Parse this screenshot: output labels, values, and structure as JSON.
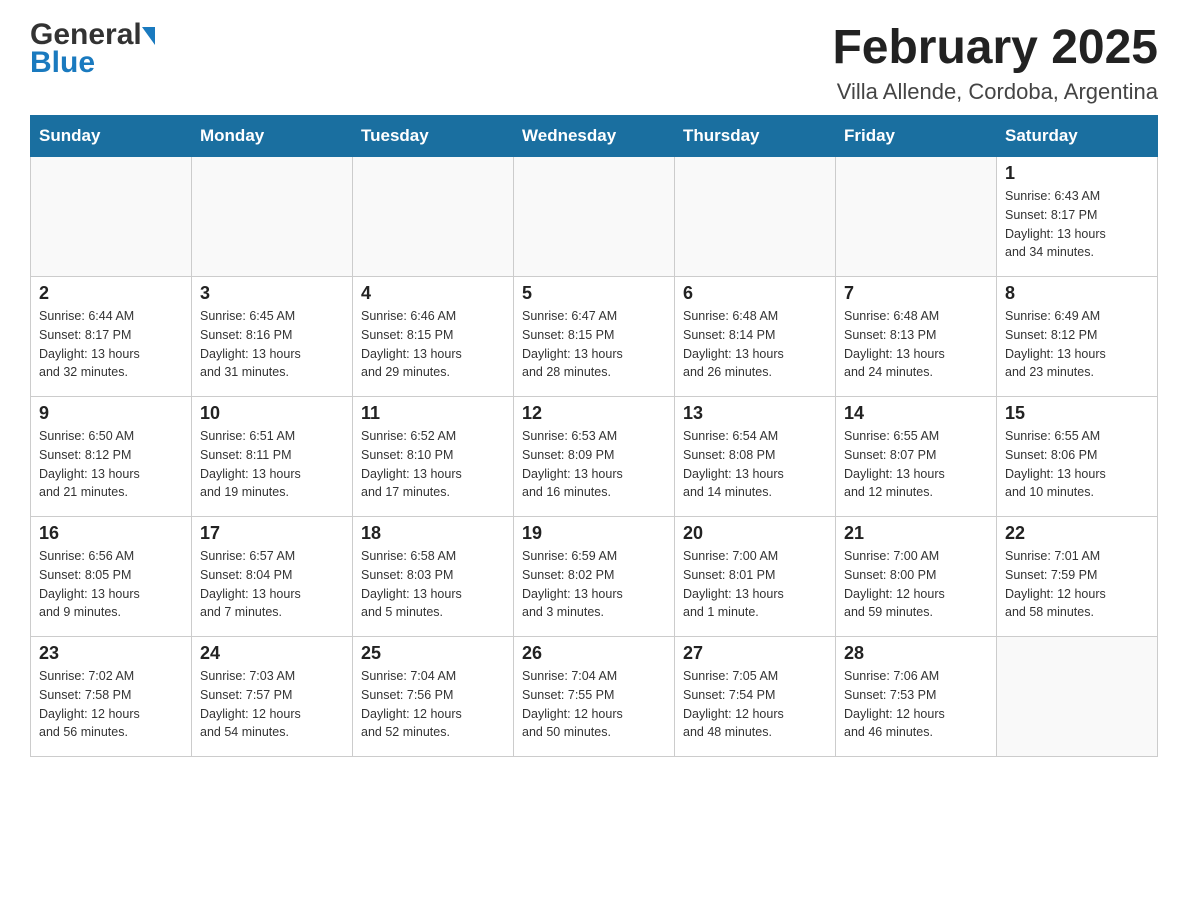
{
  "header": {
    "logo_general": "General",
    "logo_blue": "Blue",
    "title": "February 2025",
    "subtitle": "Villa Allende, Cordoba, Argentina"
  },
  "days_of_week": [
    "Sunday",
    "Monday",
    "Tuesday",
    "Wednesday",
    "Thursday",
    "Friday",
    "Saturday"
  ],
  "weeks": [
    {
      "days": [
        {
          "number": "",
          "info": ""
        },
        {
          "number": "",
          "info": ""
        },
        {
          "number": "",
          "info": ""
        },
        {
          "number": "",
          "info": ""
        },
        {
          "number": "",
          "info": ""
        },
        {
          "number": "",
          "info": ""
        },
        {
          "number": "1",
          "info": "Sunrise: 6:43 AM\nSunset: 8:17 PM\nDaylight: 13 hours\nand 34 minutes."
        }
      ]
    },
    {
      "days": [
        {
          "number": "2",
          "info": "Sunrise: 6:44 AM\nSunset: 8:17 PM\nDaylight: 13 hours\nand 32 minutes."
        },
        {
          "number": "3",
          "info": "Sunrise: 6:45 AM\nSunset: 8:16 PM\nDaylight: 13 hours\nand 31 minutes."
        },
        {
          "number": "4",
          "info": "Sunrise: 6:46 AM\nSunset: 8:15 PM\nDaylight: 13 hours\nand 29 minutes."
        },
        {
          "number": "5",
          "info": "Sunrise: 6:47 AM\nSunset: 8:15 PM\nDaylight: 13 hours\nand 28 minutes."
        },
        {
          "number": "6",
          "info": "Sunrise: 6:48 AM\nSunset: 8:14 PM\nDaylight: 13 hours\nand 26 minutes."
        },
        {
          "number": "7",
          "info": "Sunrise: 6:48 AM\nSunset: 8:13 PM\nDaylight: 13 hours\nand 24 minutes."
        },
        {
          "number": "8",
          "info": "Sunrise: 6:49 AM\nSunset: 8:12 PM\nDaylight: 13 hours\nand 23 minutes."
        }
      ]
    },
    {
      "days": [
        {
          "number": "9",
          "info": "Sunrise: 6:50 AM\nSunset: 8:12 PM\nDaylight: 13 hours\nand 21 minutes."
        },
        {
          "number": "10",
          "info": "Sunrise: 6:51 AM\nSunset: 8:11 PM\nDaylight: 13 hours\nand 19 minutes."
        },
        {
          "number": "11",
          "info": "Sunrise: 6:52 AM\nSunset: 8:10 PM\nDaylight: 13 hours\nand 17 minutes."
        },
        {
          "number": "12",
          "info": "Sunrise: 6:53 AM\nSunset: 8:09 PM\nDaylight: 13 hours\nand 16 minutes."
        },
        {
          "number": "13",
          "info": "Sunrise: 6:54 AM\nSunset: 8:08 PM\nDaylight: 13 hours\nand 14 minutes."
        },
        {
          "number": "14",
          "info": "Sunrise: 6:55 AM\nSunset: 8:07 PM\nDaylight: 13 hours\nand 12 minutes."
        },
        {
          "number": "15",
          "info": "Sunrise: 6:55 AM\nSunset: 8:06 PM\nDaylight: 13 hours\nand 10 minutes."
        }
      ]
    },
    {
      "days": [
        {
          "number": "16",
          "info": "Sunrise: 6:56 AM\nSunset: 8:05 PM\nDaylight: 13 hours\nand 9 minutes."
        },
        {
          "number": "17",
          "info": "Sunrise: 6:57 AM\nSunset: 8:04 PM\nDaylight: 13 hours\nand 7 minutes."
        },
        {
          "number": "18",
          "info": "Sunrise: 6:58 AM\nSunset: 8:03 PM\nDaylight: 13 hours\nand 5 minutes."
        },
        {
          "number": "19",
          "info": "Sunrise: 6:59 AM\nSunset: 8:02 PM\nDaylight: 13 hours\nand 3 minutes."
        },
        {
          "number": "20",
          "info": "Sunrise: 7:00 AM\nSunset: 8:01 PM\nDaylight: 13 hours\nand 1 minute."
        },
        {
          "number": "21",
          "info": "Sunrise: 7:00 AM\nSunset: 8:00 PM\nDaylight: 12 hours\nand 59 minutes."
        },
        {
          "number": "22",
          "info": "Sunrise: 7:01 AM\nSunset: 7:59 PM\nDaylight: 12 hours\nand 58 minutes."
        }
      ]
    },
    {
      "days": [
        {
          "number": "23",
          "info": "Sunrise: 7:02 AM\nSunset: 7:58 PM\nDaylight: 12 hours\nand 56 minutes."
        },
        {
          "number": "24",
          "info": "Sunrise: 7:03 AM\nSunset: 7:57 PM\nDaylight: 12 hours\nand 54 minutes."
        },
        {
          "number": "25",
          "info": "Sunrise: 7:04 AM\nSunset: 7:56 PM\nDaylight: 12 hours\nand 52 minutes."
        },
        {
          "number": "26",
          "info": "Sunrise: 7:04 AM\nSunset: 7:55 PM\nDaylight: 12 hours\nand 50 minutes."
        },
        {
          "number": "27",
          "info": "Sunrise: 7:05 AM\nSunset: 7:54 PM\nDaylight: 12 hours\nand 48 minutes."
        },
        {
          "number": "28",
          "info": "Sunrise: 7:06 AM\nSunset: 7:53 PM\nDaylight: 12 hours\nand 46 minutes."
        },
        {
          "number": "",
          "info": ""
        }
      ]
    }
  ]
}
